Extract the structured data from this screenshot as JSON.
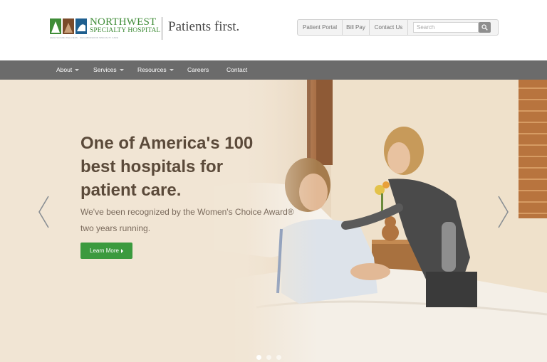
{
  "header": {
    "logo": {
      "name_line1": "NORTHWEST",
      "name_line2": "SPECIALTY HOSPITAL",
      "tagline": "HEALTHCARE WELLNESS · NEIGHBORHOOD SPECIALTY CARE"
    },
    "slogan": "Patients first.",
    "utility_links": [
      "Patient Portal",
      "Bill Pay",
      "Contact Us"
    ],
    "search": {
      "placeholder": "Search",
      "icon": "search-icon"
    }
  },
  "nav": {
    "items": [
      {
        "label": "About",
        "has_dropdown": true
      },
      {
        "label": "Services",
        "has_dropdown": true
      },
      {
        "label": "Resources",
        "has_dropdown": true
      },
      {
        "label": "Careers",
        "has_dropdown": false
      },
      {
        "label": "Contact",
        "has_dropdown": false
      }
    ]
  },
  "hero": {
    "headline": "One of America's 100 best hospitals for patient care.",
    "subtext": "We've been recognized by the Women's Choice Award® two years running.",
    "cta_label": "Learn More",
    "prev_icon": "chevron-left-icon",
    "next_icon": "chevron-right-icon",
    "slide_count": 3,
    "active_slide": 1
  },
  "colors": {
    "brand_green": "#3f8c37",
    "cta_green": "#3b9a3e",
    "nav_bg": "#6b6b6b",
    "headline": "#5b4a3a"
  }
}
